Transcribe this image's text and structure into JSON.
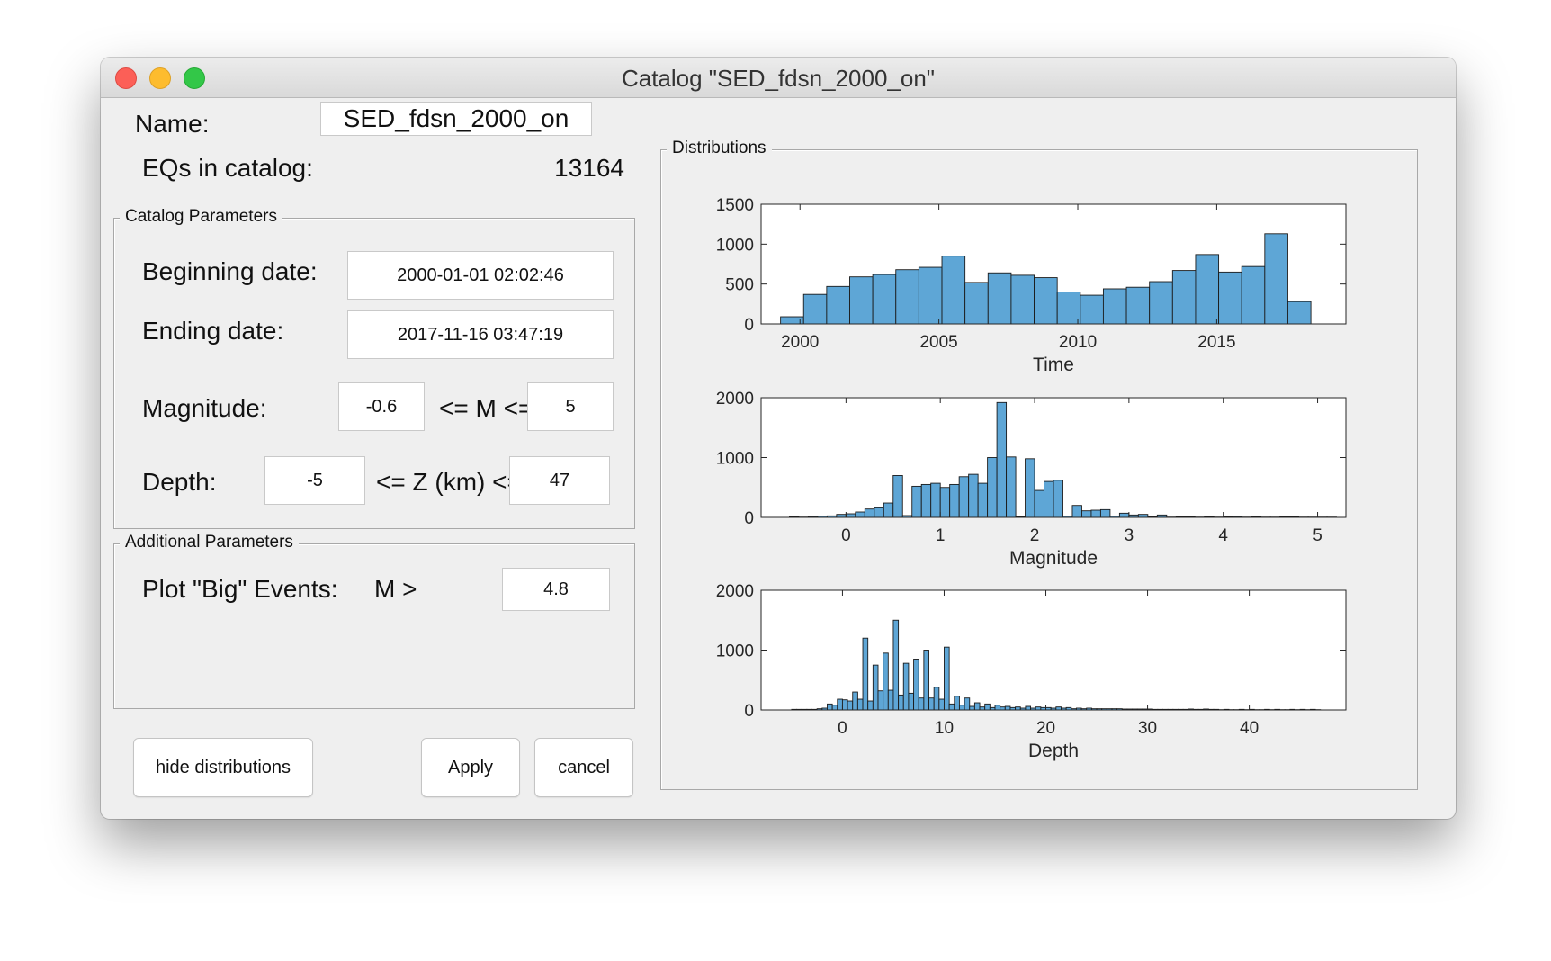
{
  "window": {
    "title": "Catalog \"SED_fdsn_2000_on\""
  },
  "name": {
    "label": "Name:",
    "value": "SED_fdsn_2000_on"
  },
  "eqs": {
    "label": "EQs in catalog:",
    "value": "13164"
  },
  "catalog_params": {
    "legend": "Catalog Parameters",
    "beginning_label": "Beginning date:",
    "beginning_value": "2000-01-01 02:02:46",
    "ending_label": "Ending date:",
    "ending_value": "2017-11-16 03:47:19",
    "magnitude_label": "Magnitude:",
    "mag_min": "-0.6",
    "mag_op": "<= M <=",
    "mag_max": "5",
    "depth_label": "Depth:",
    "depth_min": "-5",
    "depth_op": "<= Z (km) <=",
    "depth_max": "47"
  },
  "additional_params": {
    "legend": "Additional Parameters",
    "big_label": "Plot \"Big\" Events:",
    "big_op": "M >",
    "big_value": "4.8"
  },
  "buttons": {
    "hide": "hide distributions",
    "apply": "Apply",
    "cancel": "cancel"
  },
  "distributions": {
    "legend": "Distributions"
  },
  "colors": {
    "bar_fill": "#5ea6d6",
    "bar_edge": "#1b1b1b"
  },
  "chart_data": [
    {
      "type": "bar",
      "xlabel": "Time",
      "ylabel": "",
      "xlim": [
        1998.6,
        2019.65
      ],
      "ylim": [
        0,
        1500
      ],
      "xticks": [
        2000,
        2005,
        2010,
        2015
      ],
      "yticks": [
        0,
        500,
        1000,
        1500
      ],
      "bin_start": 1999.3,
      "bin_width": 0.83,
      "values": [
        90,
        370,
        470,
        590,
        620,
        680,
        710,
        850,
        520,
        640,
        610,
        580,
        400,
        360,
        440,
        460,
        530,
        670,
        870,
        650,
        720,
        1130,
        280
      ]
    },
    {
      "type": "bar",
      "xlabel": "Magnitude",
      "ylabel": "",
      "xlim": [
        -0.9,
        5.3
      ],
      "ylim": [
        0,
        2000
      ],
      "xticks": [
        0,
        1,
        2,
        3,
        4,
        5
      ],
      "yticks": [
        0,
        1000,
        2000
      ],
      "bin_start": -0.6,
      "bin_width": 0.1,
      "values": [
        10,
        5,
        15,
        20,
        25,
        50,
        60,
        90,
        140,
        160,
        240,
        700,
        30,
        520,
        550,
        570,
        500,
        550,
        680,
        720,
        570,
        1000,
        1920,
        1010,
        10,
        980,
        450,
        600,
        620,
        20,
        200,
        110,
        120,
        130,
        20,
        70,
        40,
        50,
        10,
        40,
        5,
        10,
        10,
        5,
        10,
        5,
        10,
        15,
        5,
        10,
        5,
        5,
        10,
        10,
        5,
        5,
        5,
        5
      ]
    },
    {
      "type": "bar",
      "xlabel": "Depth",
      "ylabel": "",
      "xlim": [
        -8,
        49.5
      ],
      "ylim": [
        0,
        2000
      ],
      "xticks": [
        0,
        10,
        20,
        30,
        40
      ],
      "yticks": [
        0,
        1000,
        2000
      ],
      "bin_start": -5,
      "bin_width": 0.5,
      "values": [
        10,
        10,
        10,
        10,
        10,
        20,
        30,
        100,
        80,
        180,
        170,
        150,
        300,
        180,
        1200,
        150,
        750,
        320,
        950,
        330,
        1500,
        250,
        780,
        280,
        850,
        200,
        1000,
        200,
        380,
        180,
        1050,
        100,
        230,
        80,
        200,
        60,
        120,
        50,
        100,
        40,
        80,
        50,
        60,
        40,
        50,
        30,
        60,
        30,
        50,
        40,
        40,
        30,
        50,
        30,
        40,
        20,
        30,
        20,
        30,
        20,
        20,
        20,
        20,
        20,
        20,
        15,
        15,
        15,
        15,
        15,
        15,
        10,
        10,
        10,
        10,
        10,
        10,
        10,
        15,
        10,
        10,
        15,
        10,
        10,
        5,
        10,
        5,
        5,
        10,
        5,
        10,
        5,
        5,
        10,
        5,
        10,
        5,
        5,
        10,
        5,
        10,
        5,
        10,
        5
      ]
    }
  ]
}
